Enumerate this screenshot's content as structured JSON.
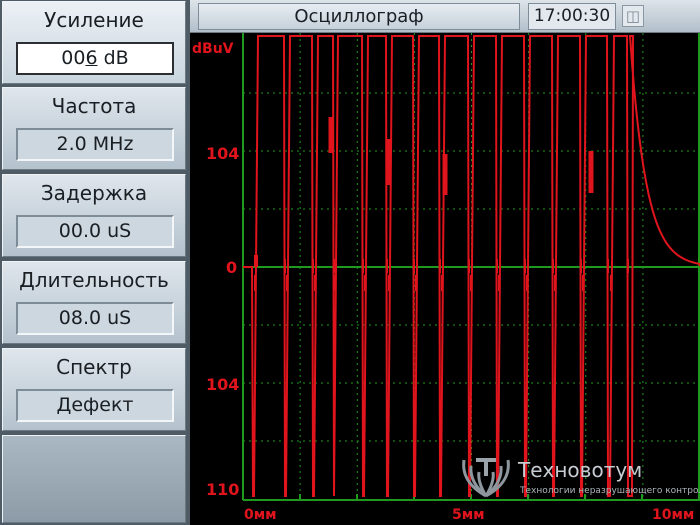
{
  "menu": [
    {
      "label": "Усиление",
      "value_prefix": "00",
      "value_cursor": "6",
      "value_suffix": " dB"
    },
    {
      "label": "Частота",
      "value": "2.0 MHz"
    },
    {
      "label": "Задержка",
      "value": "00.0 uS"
    },
    {
      "label": "Длительность",
      "value": "08.0 uS"
    },
    {
      "label": "Спектр",
      "value": "Дефект"
    }
  ],
  "topbar": {
    "title": "Осциллограф",
    "time": "17:00:30",
    "battery_icon": "battery-icon"
  },
  "plot": {
    "y_unit": "dBuV",
    "y_labels": [
      "104",
      "0",
      "104",
      "110"
    ],
    "x_labels": [
      "0мм",
      "5мм",
      "10мм"
    ]
  },
  "logo": {
    "name": "Техновотум",
    "subtitle": "Технологии неразрушающего контроля"
  },
  "colors": {
    "trace": "#e0141c",
    "grid": "#1f9a1f",
    "background": "#000000"
  }
}
